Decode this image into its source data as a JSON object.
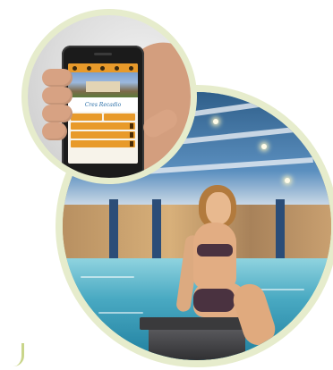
{
  "phone_app": {
    "logo_text": "Cres Recadio",
    "buttons": [
      "",
      ""
    ],
    "menu_bars": [
      "",
      "",
      ""
    ],
    "topbar_icons": [
      "home-icon",
      "star-icon",
      "mail-icon",
      "phone-icon",
      "more-icon"
    ]
  },
  "colors": {
    "ring": "#e6eccc",
    "app_accent": "#e89a2a",
    "water": "#49a9c2"
  }
}
